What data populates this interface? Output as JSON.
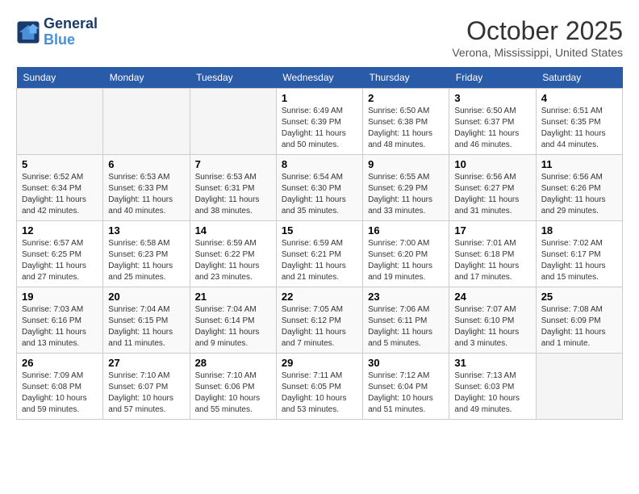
{
  "header": {
    "logo_line1": "General",
    "logo_line2": "Blue",
    "month_title": "October 2025",
    "location": "Verona, Mississippi, United States"
  },
  "days_of_week": [
    "Sunday",
    "Monday",
    "Tuesday",
    "Wednesday",
    "Thursday",
    "Friday",
    "Saturday"
  ],
  "weeks": [
    [
      {
        "day": "",
        "empty": true
      },
      {
        "day": "",
        "empty": true
      },
      {
        "day": "",
        "empty": true
      },
      {
        "day": "1",
        "sunrise": "6:49 AM",
        "sunset": "6:39 PM",
        "daylight": "11 hours and 50 minutes."
      },
      {
        "day": "2",
        "sunrise": "6:50 AM",
        "sunset": "6:38 PM",
        "daylight": "11 hours and 48 minutes."
      },
      {
        "day": "3",
        "sunrise": "6:50 AM",
        "sunset": "6:37 PM",
        "daylight": "11 hours and 46 minutes."
      },
      {
        "day": "4",
        "sunrise": "6:51 AM",
        "sunset": "6:35 PM",
        "daylight": "11 hours and 44 minutes."
      }
    ],
    [
      {
        "day": "5",
        "sunrise": "6:52 AM",
        "sunset": "6:34 PM",
        "daylight": "11 hours and 42 minutes."
      },
      {
        "day": "6",
        "sunrise": "6:53 AM",
        "sunset": "6:33 PM",
        "daylight": "11 hours and 40 minutes."
      },
      {
        "day": "7",
        "sunrise": "6:53 AM",
        "sunset": "6:31 PM",
        "daylight": "11 hours and 38 minutes."
      },
      {
        "day": "8",
        "sunrise": "6:54 AM",
        "sunset": "6:30 PM",
        "daylight": "11 hours and 35 minutes."
      },
      {
        "day": "9",
        "sunrise": "6:55 AM",
        "sunset": "6:29 PM",
        "daylight": "11 hours and 33 minutes."
      },
      {
        "day": "10",
        "sunrise": "6:56 AM",
        "sunset": "6:27 PM",
        "daylight": "11 hours and 31 minutes."
      },
      {
        "day": "11",
        "sunrise": "6:56 AM",
        "sunset": "6:26 PM",
        "daylight": "11 hours and 29 minutes."
      }
    ],
    [
      {
        "day": "12",
        "sunrise": "6:57 AM",
        "sunset": "6:25 PM",
        "daylight": "11 hours and 27 minutes."
      },
      {
        "day": "13",
        "sunrise": "6:58 AM",
        "sunset": "6:23 PM",
        "daylight": "11 hours and 25 minutes."
      },
      {
        "day": "14",
        "sunrise": "6:59 AM",
        "sunset": "6:22 PM",
        "daylight": "11 hours and 23 minutes."
      },
      {
        "day": "15",
        "sunrise": "6:59 AM",
        "sunset": "6:21 PM",
        "daylight": "11 hours and 21 minutes."
      },
      {
        "day": "16",
        "sunrise": "7:00 AM",
        "sunset": "6:20 PM",
        "daylight": "11 hours and 19 minutes."
      },
      {
        "day": "17",
        "sunrise": "7:01 AM",
        "sunset": "6:18 PM",
        "daylight": "11 hours and 17 minutes."
      },
      {
        "day": "18",
        "sunrise": "7:02 AM",
        "sunset": "6:17 PM",
        "daylight": "11 hours and 15 minutes."
      }
    ],
    [
      {
        "day": "19",
        "sunrise": "7:03 AM",
        "sunset": "6:16 PM",
        "daylight": "11 hours and 13 minutes."
      },
      {
        "day": "20",
        "sunrise": "7:04 AM",
        "sunset": "6:15 PM",
        "daylight": "11 hours and 11 minutes."
      },
      {
        "day": "21",
        "sunrise": "7:04 AM",
        "sunset": "6:14 PM",
        "daylight": "11 hours and 9 minutes."
      },
      {
        "day": "22",
        "sunrise": "7:05 AM",
        "sunset": "6:12 PM",
        "daylight": "11 hours and 7 minutes."
      },
      {
        "day": "23",
        "sunrise": "7:06 AM",
        "sunset": "6:11 PM",
        "daylight": "11 hours and 5 minutes."
      },
      {
        "day": "24",
        "sunrise": "7:07 AM",
        "sunset": "6:10 PM",
        "daylight": "11 hours and 3 minutes."
      },
      {
        "day": "25",
        "sunrise": "7:08 AM",
        "sunset": "6:09 PM",
        "daylight": "11 hours and 1 minute."
      }
    ],
    [
      {
        "day": "26",
        "sunrise": "7:09 AM",
        "sunset": "6:08 PM",
        "daylight": "10 hours and 59 minutes."
      },
      {
        "day": "27",
        "sunrise": "7:10 AM",
        "sunset": "6:07 PM",
        "daylight": "10 hours and 57 minutes."
      },
      {
        "day": "28",
        "sunrise": "7:10 AM",
        "sunset": "6:06 PM",
        "daylight": "10 hours and 55 minutes."
      },
      {
        "day": "29",
        "sunrise": "7:11 AM",
        "sunset": "6:05 PM",
        "daylight": "10 hours and 53 minutes."
      },
      {
        "day": "30",
        "sunrise": "7:12 AM",
        "sunset": "6:04 PM",
        "daylight": "10 hours and 51 minutes."
      },
      {
        "day": "31",
        "sunrise": "7:13 AM",
        "sunset": "6:03 PM",
        "daylight": "10 hours and 49 minutes."
      },
      {
        "day": "",
        "empty": true
      }
    ]
  ]
}
